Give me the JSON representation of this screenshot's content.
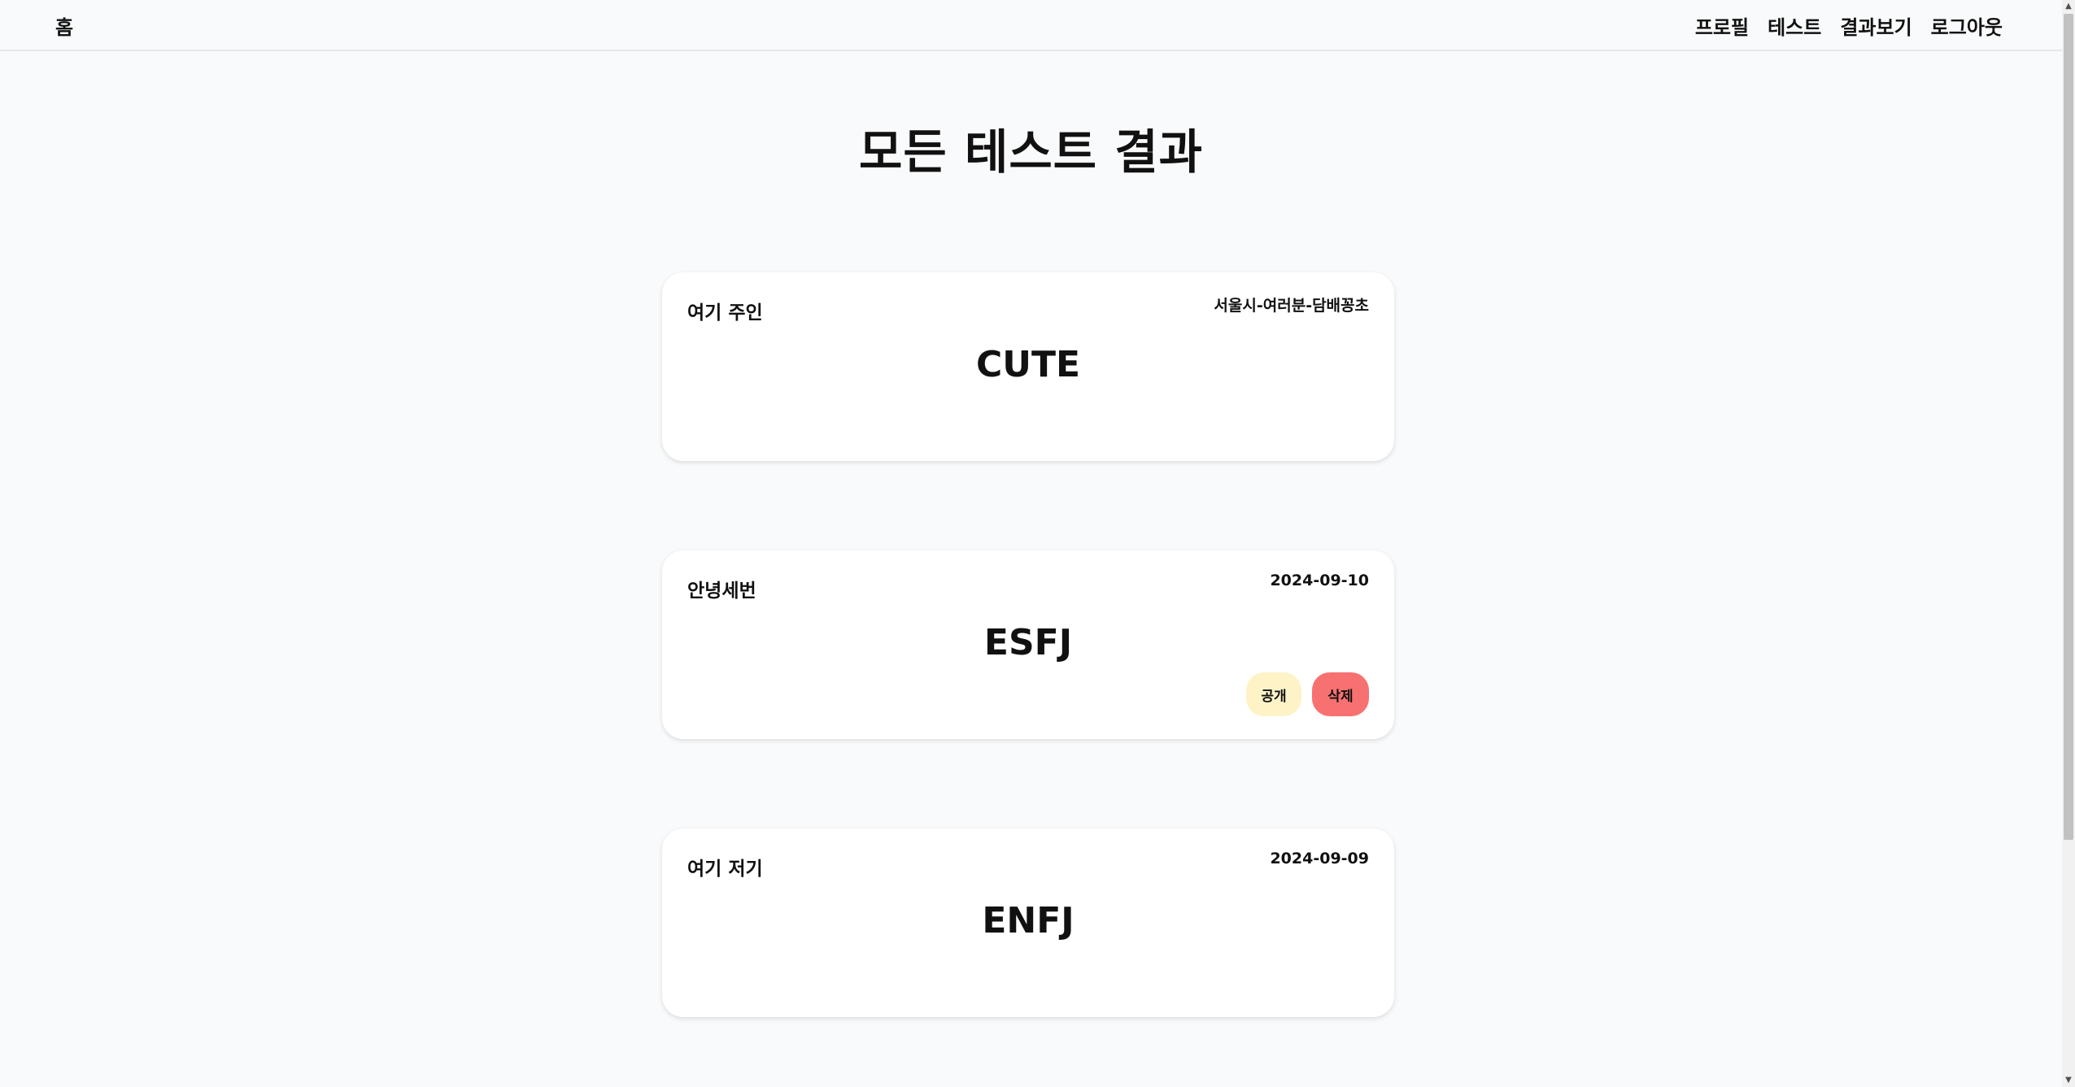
{
  "nav": {
    "home": "홈",
    "links": [
      "프로필",
      "테스트",
      "결과보기",
      "로그아웃"
    ]
  },
  "page": {
    "title": "모든 테스트 결과"
  },
  "results": [
    {
      "name": "여기 주인",
      "meta": "서울시-여러분-담배꽁초",
      "type": "CUTE"
    },
    {
      "name": "안녕세번",
      "meta": "2024-09-10",
      "type": "ESFJ",
      "actions": {
        "public_label": "공개",
        "delete_label": "삭제"
      }
    },
    {
      "name": "여기 저기",
      "meta": "2024-09-09",
      "type": "ENFJ"
    }
  ],
  "colors": {
    "background": "#f9fafb",
    "card": "#ffffff",
    "public_button": "#fef3c7",
    "delete_button": "#f87171"
  },
  "icons": {
    "scroll_up": "triangle-up",
    "scroll_down": "triangle-down"
  }
}
